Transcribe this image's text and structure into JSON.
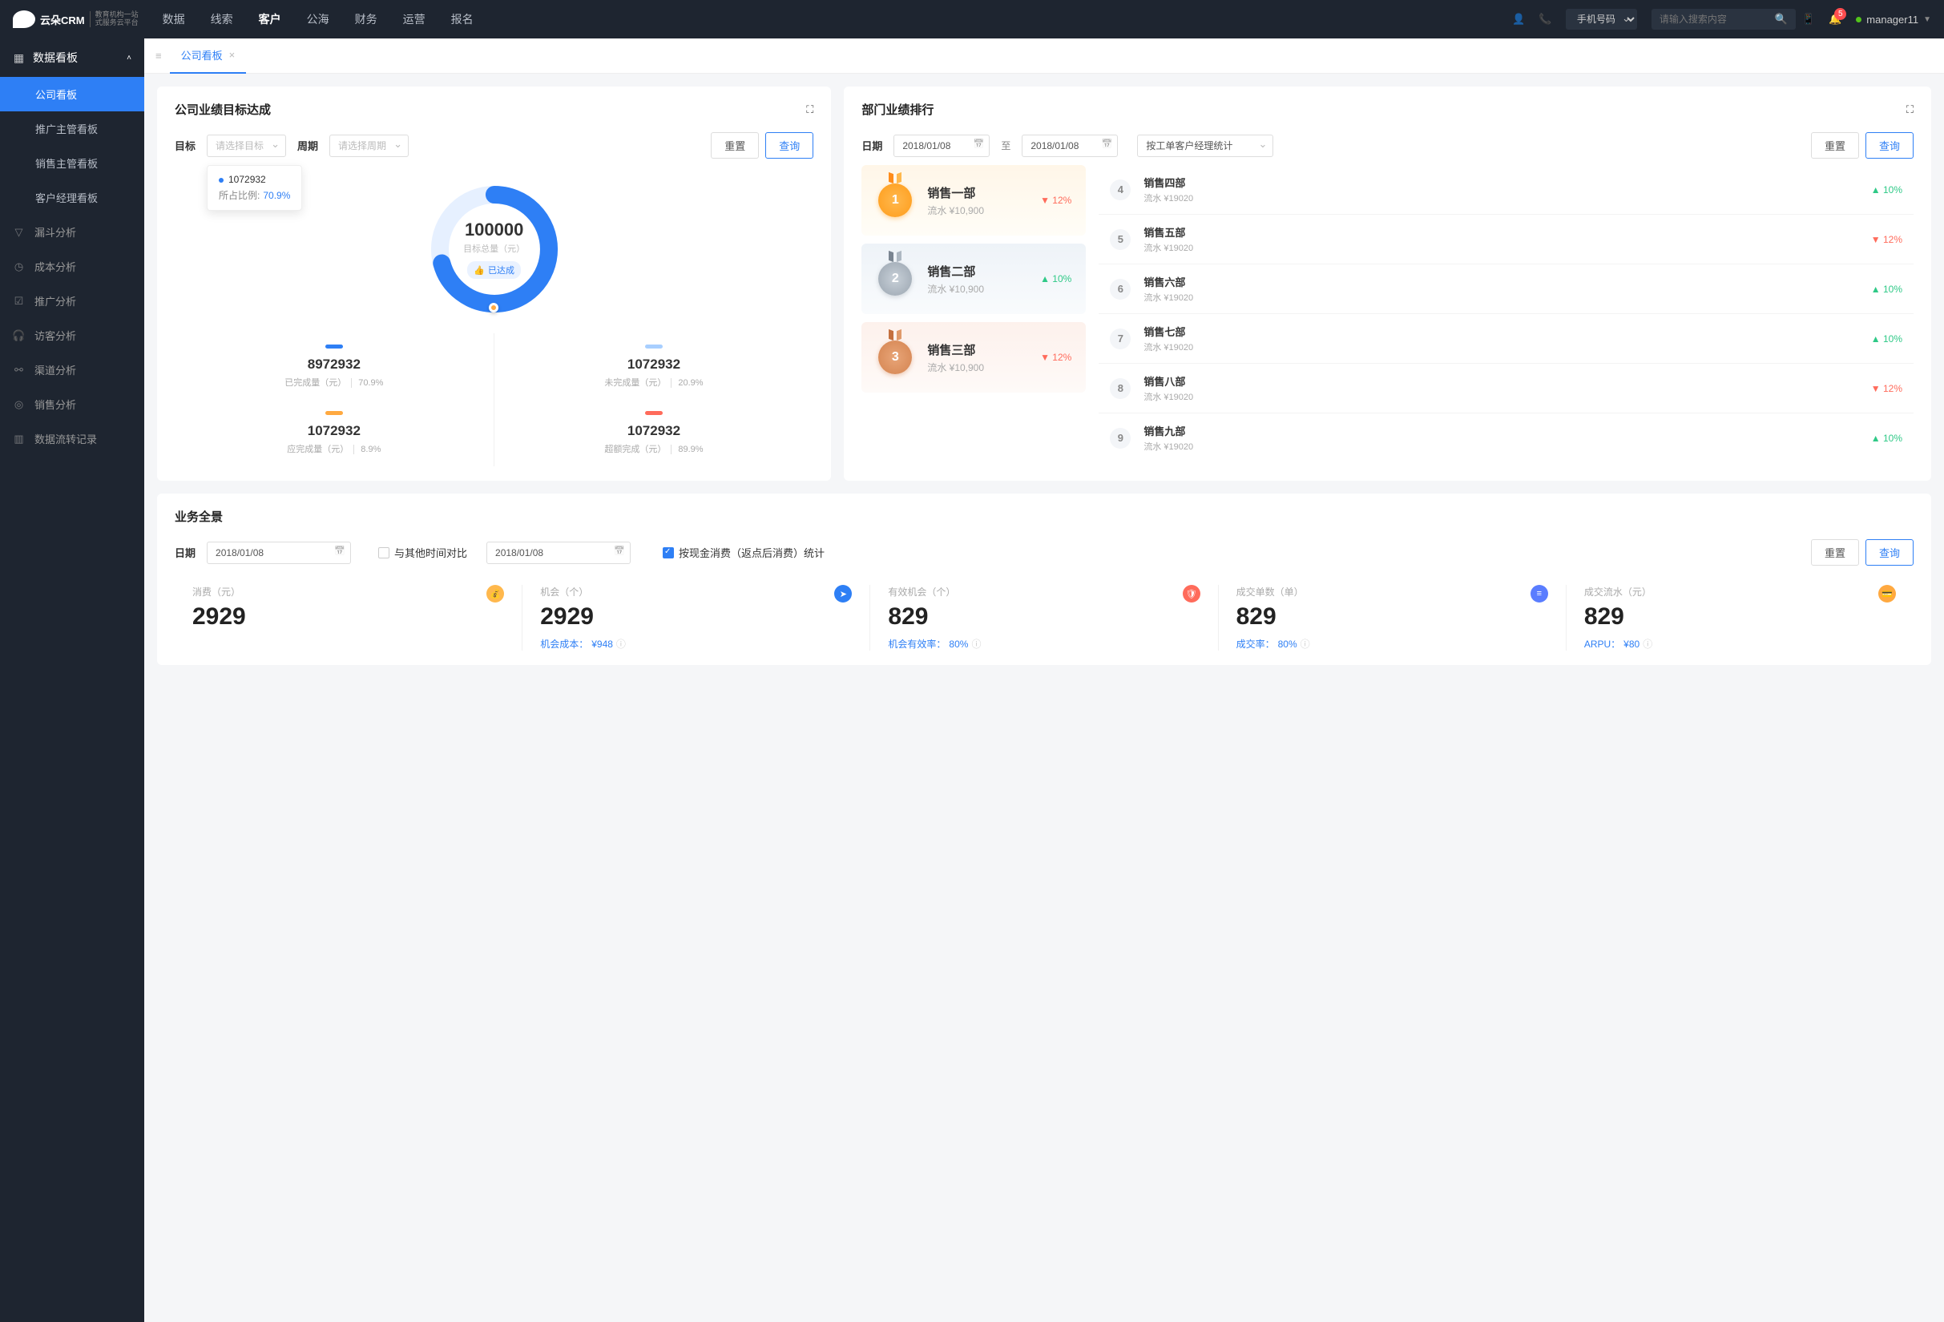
{
  "top": {
    "logo": "云朵CRM",
    "logo_sub1": "教育机构一站",
    "logo_sub2": "式服务云平台",
    "nav": [
      "数据",
      "线索",
      "客户",
      "公海",
      "财务",
      "运营",
      "报名"
    ],
    "nav_active": 2,
    "search_type": "手机号码",
    "search_ph": "请输入搜索内容",
    "badge": "5",
    "user": "manager11"
  },
  "side": {
    "header": "数据看板",
    "items": [
      "公司看板",
      "推广主管看板",
      "销售主管看板",
      "客户经理看板"
    ],
    "active": 0,
    "cats": [
      "漏斗分析",
      "成本分析",
      "推广分析",
      "访客分析",
      "渠道分析",
      "销售分析",
      "数据流转记录"
    ]
  },
  "tab": {
    "label": "公司看板"
  },
  "goal": {
    "title": "公司业绩目标达成",
    "target_lbl": "目标",
    "target_ph": "请选择目标",
    "period_lbl": "周期",
    "period_ph": "请选择周期",
    "reset": "重置",
    "query": "查询",
    "tooltip_val": "1072932",
    "tooltip_lbl": "所占比例:",
    "tooltip_pct": "70.9%",
    "center_val": "100000",
    "center_lbl": "目标总量（元）",
    "achieved": "已达成",
    "s1_v": "8972932",
    "s1_l": "已完成量（元）",
    "s1_p": "70.9%",
    "s2_v": "1072932",
    "s2_l": "未完成量（元）",
    "s2_p": "20.9%",
    "s3_v": "1072932",
    "s3_l": "应完成量（元）",
    "s3_p": "8.9%",
    "s4_v": "1072932",
    "s4_l": "超额完成（元）",
    "s4_p": "89.9%"
  },
  "rank": {
    "title": "部门业绩排行",
    "date_lbl": "日期",
    "from": "2018/01/08",
    "to_lbl": "至",
    "to": "2018/01/08",
    "stat_lbl": "按工单客户经理统计",
    "reset": "重置",
    "query": "查询",
    "top3": [
      {
        "n": "1",
        "name": "销售一部",
        "sub": "流水 ¥10,900",
        "dir": "down",
        "pct": "12%"
      },
      {
        "n": "2",
        "name": "销售二部",
        "sub": "流水 ¥10,900",
        "dir": "up",
        "pct": "10%"
      },
      {
        "n": "3",
        "name": "销售三部",
        "sub": "流水 ¥10,900",
        "dir": "down",
        "pct": "12%"
      }
    ],
    "list": [
      {
        "n": "4",
        "name": "销售四部",
        "sub": "流水 ¥19020",
        "dir": "up",
        "pct": "10%"
      },
      {
        "n": "5",
        "name": "销售五部",
        "sub": "流水 ¥19020",
        "dir": "down",
        "pct": "12%"
      },
      {
        "n": "6",
        "name": "销售六部",
        "sub": "流水 ¥19020",
        "dir": "up",
        "pct": "10%"
      },
      {
        "n": "7",
        "name": "销售七部",
        "sub": "流水 ¥19020",
        "dir": "up",
        "pct": "10%"
      },
      {
        "n": "8",
        "name": "销售八部",
        "sub": "流水 ¥19020",
        "dir": "down",
        "pct": "12%"
      },
      {
        "n": "9",
        "name": "销售九部",
        "sub": "流水 ¥19020",
        "dir": "up",
        "pct": "10%"
      }
    ]
  },
  "pano": {
    "title": "业务全景",
    "date_lbl": "日期",
    "date1": "2018/01/08",
    "cmp_lbl": "与其他时间对比",
    "date2": "2018/01/08",
    "chk_lbl": "按现金消费（返点后消费）统计",
    "reset": "重置",
    "query": "查询",
    "m": [
      {
        "l": "消费（元）",
        "v": "2929",
        "f": "",
        "fv": ""
      },
      {
        "l": "机会（个）",
        "v": "2929",
        "f": "机会成本：",
        "fv": "¥948"
      },
      {
        "l": "有效机会（个）",
        "v": "829",
        "f": "机会有效率：",
        "fv": "80%"
      },
      {
        "l": "成交单数（单）",
        "v": "829",
        "f": "成交率：",
        "fv": "80%"
      },
      {
        "l": "成交流水（元）",
        "v": "829",
        "f": "ARPU：",
        "fv": "¥80"
      }
    ]
  },
  "chart_data": {
    "type": "pie",
    "title": "目标总量（元）",
    "total": 100000,
    "series": [
      {
        "name": "已完成量",
        "value": 70.9,
        "color": "#2e7ff5"
      },
      {
        "name": "未完成量",
        "value": 29.1,
        "color": "#d6e6ff"
      }
    ]
  }
}
